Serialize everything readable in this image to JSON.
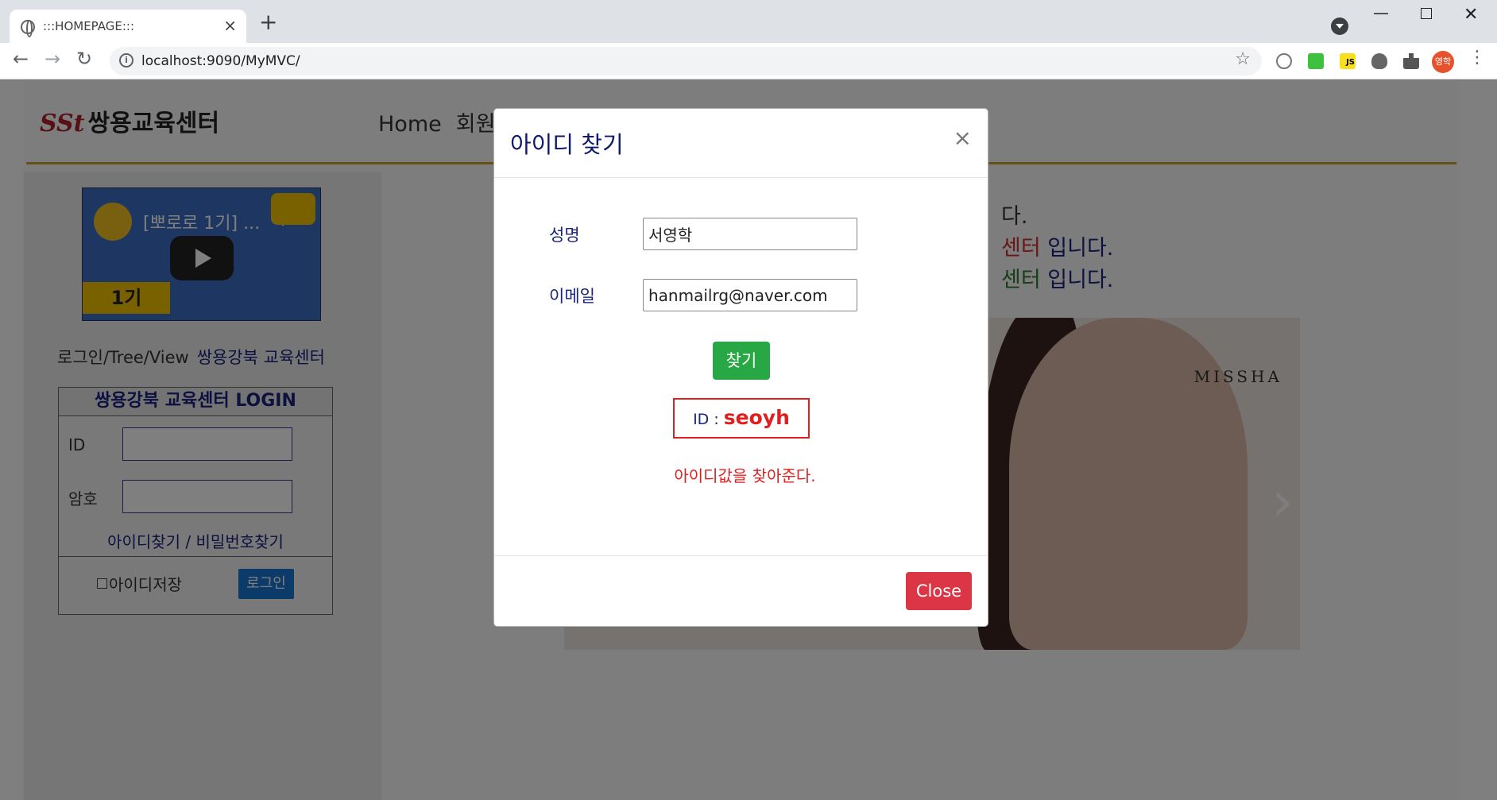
{
  "browser": {
    "tab_title": ":::HOMEPAGE:::",
    "tab_close": "×",
    "new_tab": "+",
    "url": "localhost:9090/MyMVC/",
    "profile_initials": "영학",
    "ext_js_label": "JS"
  },
  "header": {
    "logo_mark": "SSt",
    "logo_text": "쌍용교육센터",
    "nav": [
      "Home",
      "회원"
    ]
  },
  "sidebar": {
    "video_title": "[뽀로로 1기] ...",
    "video_badge": "1기",
    "links": [
      "로그인/Tree/View",
      "쌍용강북 교육센터"
    ],
    "login": {
      "title": "쌍용강북 교육센터 LOGIN",
      "id_label": "ID",
      "pw_label": "암호",
      "find_links": "아이디찾기 / 비밀번호찾기",
      "save_id_label": "아이디저장",
      "login_button": "로그인"
    }
  },
  "main": {
    "welcome_lines": [
      {
        "prefix": "다.",
        "highlight": "",
        "suffix": ""
      },
      {
        "prefix": "",
        "highlight": "센터",
        "suffix": " 입니다."
      },
      {
        "prefix": "",
        "highlight": "센터",
        "suffix": " 입니다."
      }
    ],
    "banner_brand": "MISSHA"
  },
  "modal": {
    "title": "아이디 찾기",
    "close_x": "×",
    "name_label": "성명",
    "name_value": "서영학",
    "email_label": "이메일",
    "email_value": "hanmailrg@naver.com",
    "find_button": "찾기",
    "result_label": "ID : ",
    "result_value": "seoyh",
    "note": "아이디값을 찾아준다.",
    "close_button": "Close"
  }
}
